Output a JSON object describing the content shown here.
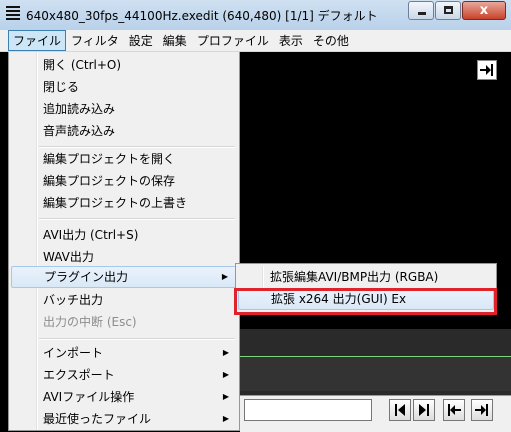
{
  "window": {
    "title": "640x480_30fps_44100Hz.exedit (640,480)  [1/1]  デフォルト",
    "close_glyph": "x"
  },
  "menubar": {
    "items": [
      "ファイル",
      "フィルタ",
      "設定",
      "編集",
      "プロファイル",
      "表示",
      "その他"
    ],
    "active": "ファイル"
  },
  "file_menu": {
    "items": [
      {
        "label": "開く (Ctrl+O)",
        "state": "normal"
      },
      {
        "label": "閉じる",
        "state": "normal"
      },
      {
        "label": "追加読み込み",
        "state": "normal"
      },
      {
        "label": "音声読み込み",
        "state": "normal"
      },
      {
        "label": "編集プロジェクトを開く",
        "state": "normal"
      },
      {
        "label": "編集プロジェクトの保存",
        "state": "normal"
      },
      {
        "label": "編集プロジェクトの上書き",
        "state": "normal"
      },
      {
        "label": "AVI出力 (Ctrl+S)",
        "state": "normal"
      },
      {
        "label": "WAV出力",
        "state": "normal"
      },
      {
        "label": "プラグイン出力",
        "state": "highlighted",
        "submenu": true
      },
      {
        "label": "バッチ出力",
        "state": "normal"
      },
      {
        "label": "出力の中断 (Esc)",
        "state": "disabled"
      },
      {
        "label": "インポート",
        "state": "normal",
        "submenu": true
      },
      {
        "label": "エクスポート",
        "state": "normal",
        "submenu": true
      },
      {
        "label": "AVIファイル操作",
        "state": "normal",
        "submenu": true
      },
      {
        "label": "最近使ったファイル",
        "state": "normal",
        "submenu": true
      }
    ],
    "submenu_arrow": "▶"
  },
  "plugin_submenu": {
    "items": [
      {
        "label": "拡張編集AVI/BMP出力 (RGBA)",
        "state": "normal"
      },
      {
        "label": "拡張 x264 出力(GUI) Ex",
        "state": "highlighted"
      }
    ]
  },
  "colors": {
    "annotation_box": "#e0222a",
    "timeline_line": "#7fd47f"
  },
  "icons": {
    "goto_end": "goto-end-icon",
    "prev_frame": "step-back-icon",
    "next_frame": "step-forward-icon",
    "goto_start": "goto-start-icon"
  }
}
